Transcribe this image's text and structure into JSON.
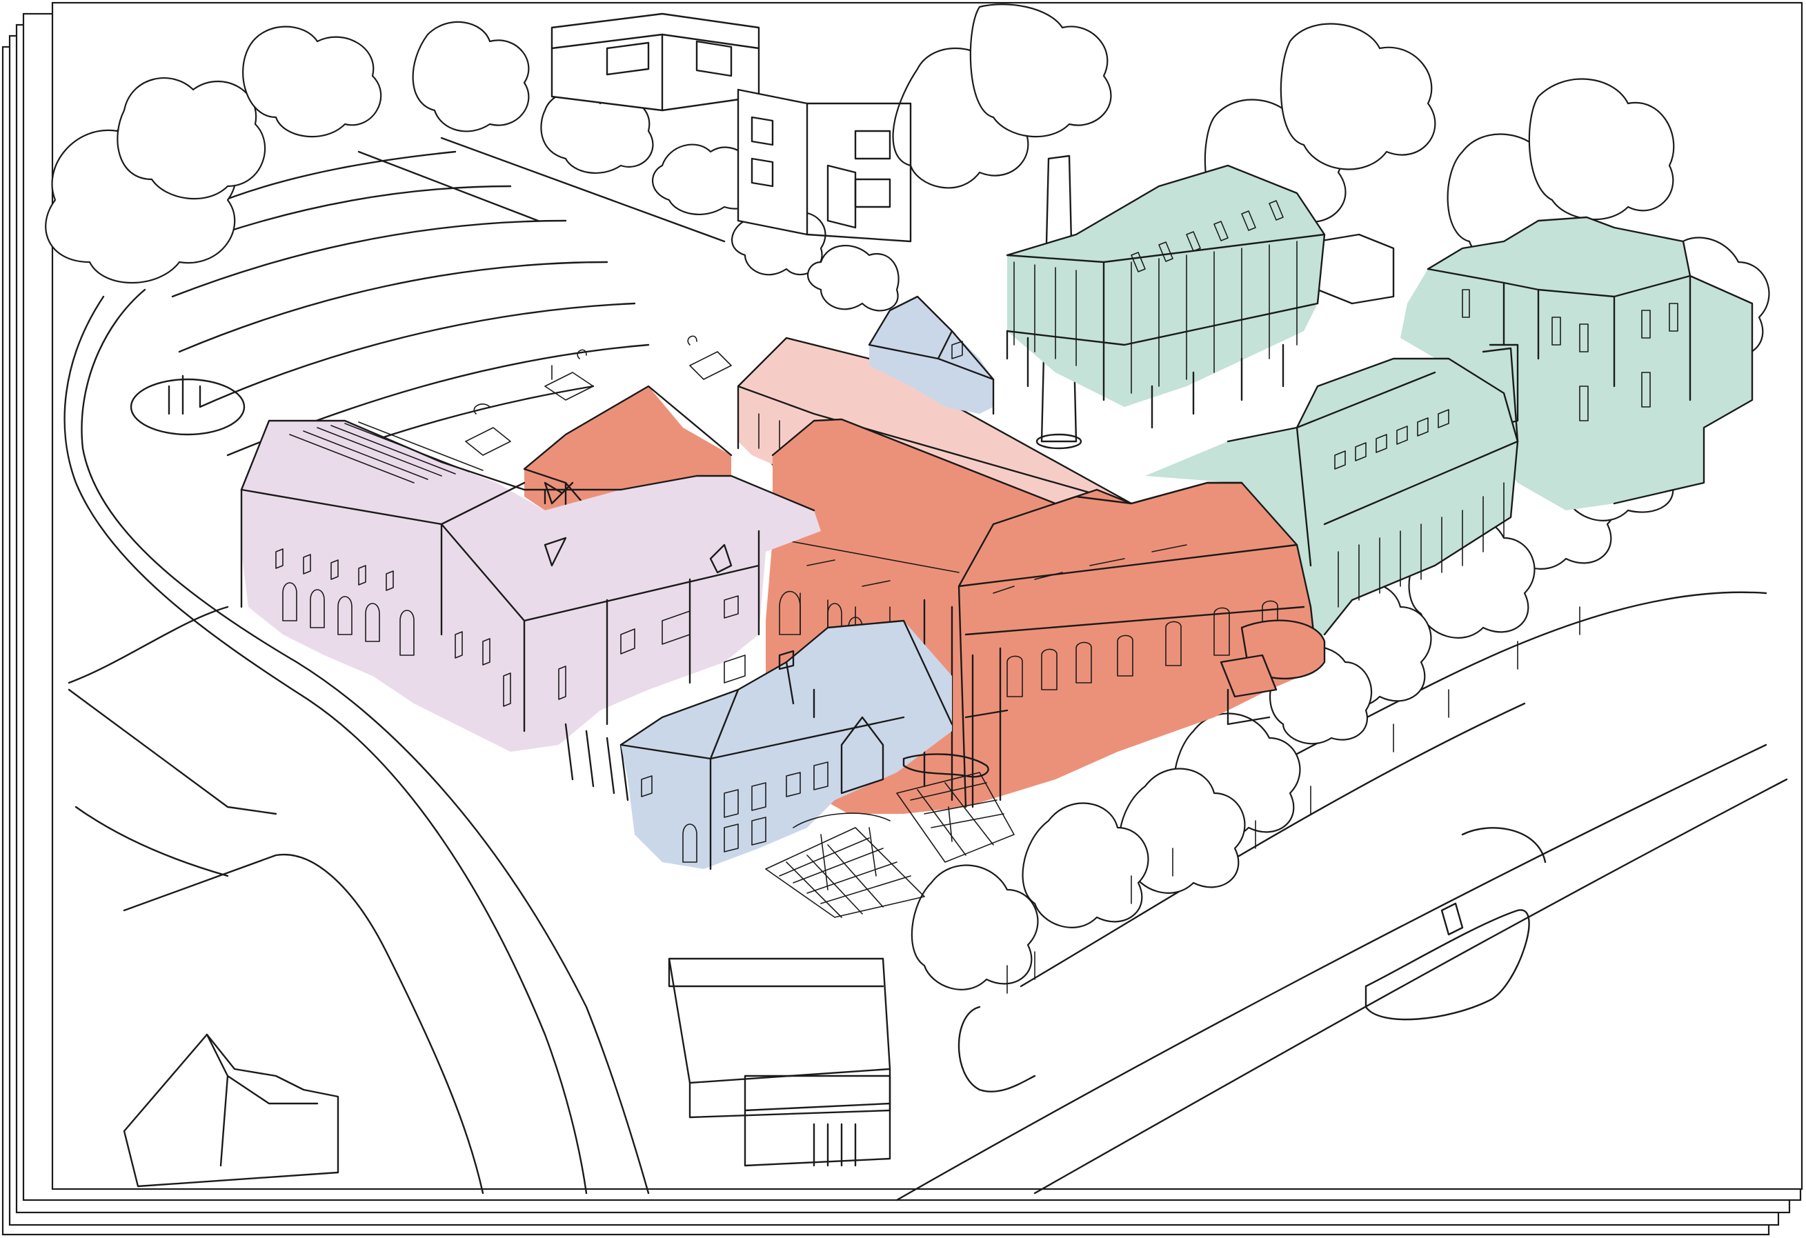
{
  "drawing": {
    "kind": "hand-drawn axonometric site sketch",
    "sheet_stack_count": 5,
    "colors": {
      "ink": "#1a1a1a",
      "paper": "#ffffff",
      "red_terracotta": "#ec9179",
      "pink": "#f6cdc6",
      "lilac": "#eadbea",
      "blue": "#cad7e9",
      "green_mint": "#c4e2d7"
    },
    "building_groups": [
      {
        "name": "lilac-terrace-building",
        "color": "lilac"
      },
      {
        "name": "red-gable-house",
        "color": "red_terracotta"
      },
      {
        "name": "red-warehouse-hall",
        "color": "red_terracotta"
      },
      {
        "name": "pink-long-shed",
        "color": "pink"
      },
      {
        "name": "blue-cottage-front",
        "color": "blue"
      },
      {
        "name": "blue-cottage-rear",
        "color": "blue"
      },
      {
        "name": "green-mill-block",
        "color": "green_mint"
      },
      {
        "name": "green-terrace-block",
        "color": "green_mint"
      },
      {
        "name": "green-tall-building",
        "color": "green_mint"
      }
    ]
  }
}
